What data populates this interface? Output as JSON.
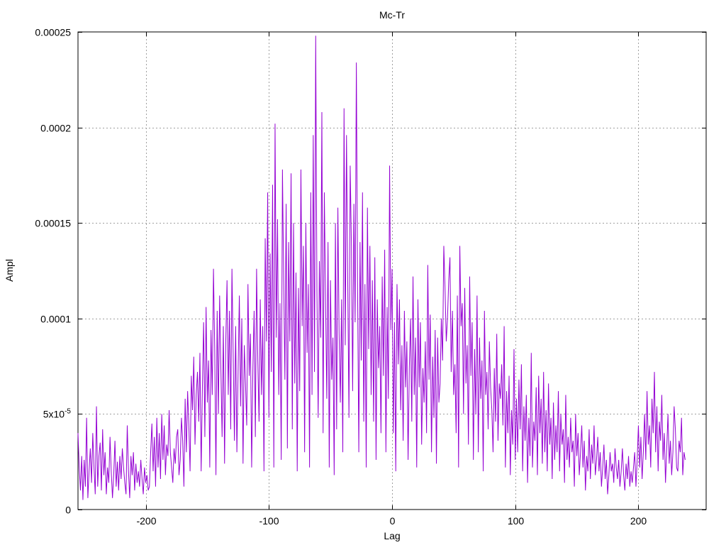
{
  "chart_data": {
    "type": "line",
    "title": "Mc-Tr",
    "xlabel": "Lag",
    "ylabel": "Ampl",
    "xlim": [
      -255,
      255
    ],
    "ylim": [
      0,
      0.00025
    ],
    "grid": true,
    "xticks": [
      {
        "value": -200,
        "label": "-200"
      },
      {
        "value": -100,
        "label": "-100"
      },
      {
        "value": 0,
        "label": "0"
      },
      {
        "value": 100,
        "label": "100"
      },
      {
        "value": 200,
        "label": "200"
      }
    ],
    "yticks": [
      {
        "value": 0,
        "label": "0"
      },
      {
        "value": 5e-05,
        "label": "5x10",
        "sup": "-5"
      },
      {
        "value": 0.0001,
        "label": "0.0001"
      },
      {
        "value": 0.00015,
        "label": "0.00015"
      },
      {
        "value": 0.0002,
        "label": "0.0002"
      },
      {
        "value": 0.00025,
        "label": "0.00025"
      }
    ],
    "series": [
      {
        "color": "#9400d3",
        "note": "Amplitude vs lag, one sample per integer lag from -255 to 255; values in units of 1e-6",
        "x_start": -255,
        "x_step": 1,
        "scale": 1e-06,
        "values": [
          40,
          22,
          10,
          28,
          5,
          26,
          12,
          48,
          6,
          20,
          32,
          14,
          40,
          22,
          8,
          54,
          12,
          28,
          35,
          10,
          42,
          18,
          30,
          8,
          22,
          14,
          38,
          20,
          6,
          18,
          36,
          12,
          25,
          10,
          28,
          16,
          32,
          22,
          14,
          8,
          44,
          20,
          6,
          28,
          18,
          30,
          10,
          24,
          14,
          20,
          12,
          26,
          16,
          8,
          22,
          14,
          18,
          10,
          12,
          30,
          45,
          20,
          38,
          12,
          48,
          22,
          40,
          16,
          50,
          26,
          44,
          18,
          34,
          28,
          52,
          30,
          22,
          14,
          32,
          24,
          38,
          42,
          18,
          26,
          48,
          36,
          12,
          58,
          30,
          62,
          44,
          20,
          70,
          52,
          80,
          34,
          60,
          72,
          46,
          82,
          20,
          64,
          98,
          38,
          106,
          56,
          78,
          22,
          94,
          60,
          126,
          84,
          18,
          104,
          50,
          112,
          74,
          38,
          96,
          24,
          88,
          120,
          60,
          104,
          42,
          126,
          82,
          36,
          96,
          30,
          72,
          112,
          54,
          100,
          24,
          86,
          66,
          44,
          118,
          70,
          92,
          22,
          74,
          104,
          38,
          126,
          78,
          46,
          110,
          60,
          96,
          20,
          142,
          88,
          166,
          48,
          134,
          72,
          170,
          22,
          202,
          90,
          152,
          60,
          108,
          26,
          178,
          120,
          68,
          160,
          32,
          140,
          88,
          176,
          42,
          150,
          66,
          124,
          20,
          116,
          62,
          178,
          96,
          138,
          30,
          150,
          82,
          118,
          22,
          166,
          60,
          196,
          72,
          248,
          114,
          48,
          130,
          90,
          208,
          40,
          166,
          110,
          58,
          140,
          22,
          120,
          68,
          90,
          18,
          150,
          42,
          158,
          92,
          56,
          110,
          30,
          210,
          86,
          196,
          120,
          48,
          180,
          138,
          62,
          160,
          98,
          234,
          116,
          30,
          140,
          78,
          166,
          46,
          118,
          22,
          158,
          84,
          138,
          60,
          120,
          46,
          132,
          26,
          110,
          74,
          96,
          40,
          122,
          70,
          136,
          30,
          106,
          58,
          180,
          94,
          126,
          40,
          98,
          20,
          118,
          76,
          110,
          52,
          86,
          36,
          104,
          64,
          88,
          26,
          74,
          100,
          46,
          122,
          60,
          90,
          22,
          110,
          64,
          98,
          34,
          74,
          56,
          88,
          40,
          128,
          68,
          102,
          30,
          80,
          48,
          94,
          24,
          90,
          56,
          66,
          100,
          78,
          138,
          116,
          88,
          100,
          120,
          132,
          72,
          104,
          60,
          76,
          40,
          112,
          22,
          138,
          96,
          108,
          50,
          116,
          66,
          86,
          34,
          122,
          70,
          98,
          26,
          84,
          50,
          112,
          30,
          90,
          58,
          78,
          20,
          104,
          60,
          72,
          42,
          88,
          64,
          52,
          30,
          74,
          46,
          92,
          36,
          66,
          58,
          76,
          44,
          96,
          22,
          62,
          40,
          70,
          18,
          52,
          34,
          84,
          26,
          58,
          30,
          68,
          42,
          76,
          20,
          54,
          36,
          60,
          14,
          48,
          28,
          82,
          22,
          46,
          36,
          64,
          18,
          70,
          40,
          58,
          24,
          72,
          30,
          52,
          20,
          66,
          34,
          48,
          16,
          56,
          26,
          44,
          30,
          62,
          20,
          50,
          34,
          42,
          14,
          60,
          26,
          38,
          22,
          48,
          30,
          36,
          12,
          50,
          28,
          40,
          18,
          30,
          44,
          22,
          36,
          10,
          28,
          20,
          42,
          16,
          34,
          24,
          44,
          18,
          26,
          38,
          20,
          30,
          12,
          22,
          34,
          16,
          26,
          8,
          18,
          30,
          20,
          24,
          14,
          32,
          22,
          16,
          26,
          12,
          20,
          32,
          18,
          10,
          24,
          16,
          28,
          12,
          20,
          14,
          22,
          30,
          12,
          26,
          44,
          22,
          38,
          16,
          30,
          50,
          26,
          62,
          34,
          44,
          22,
          58,
          40,
          72,
          30,
          54,
          20,
          46,
          36,
          60,
          26,
          40,
          14,
          32,
          50,
          24,
          36,
          18,
          30,
          54,
          42,
          22,
          20,
          36,
          30,
          48,
          18,
          30,
          26
        ]
      }
    ]
  }
}
